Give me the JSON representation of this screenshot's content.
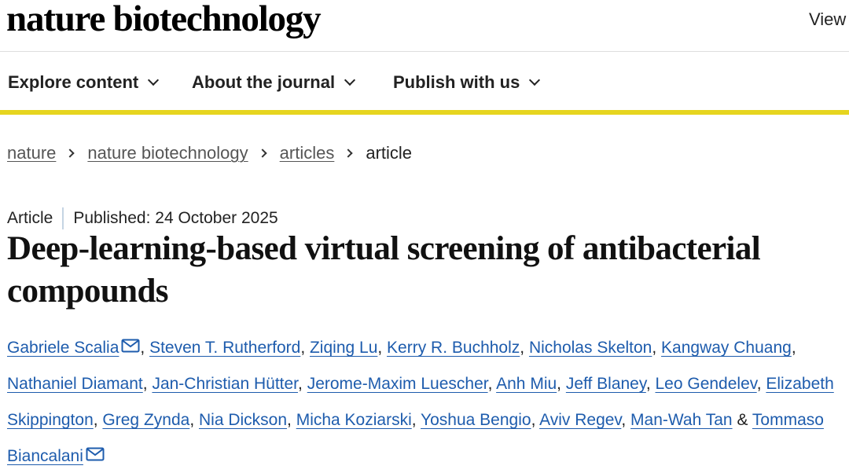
{
  "header": {
    "logo_text": "nature biotechnology",
    "view_link": "View"
  },
  "nav": {
    "items": [
      {
        "label": "Explore content"
      },
      {
        "label": "About the journal"
      },
      {
        "label": "Publish with us"
      }
    ],
    "accent_color": "#e6d51f"
  },
  "breadcrumb": {
    "items": [
      "nature",
      "nature biotechnology",
      "articles"
    ],
    "current": "article"
  },
  "article": {
    "type": "Article",
    "published": "Published: 24 October 2025",
    "title": "Deep-learning-based virtual screening of antibacterial compounds",
    "authors": [
      "Gabriele Scalia",
      "Steven T. Rutherford",
      "Ziqing Lu",
      "Kerry R. Buchholz",
      "Nicholas Skelton",
      "Kangway Chuang",
      "Nathaniel Diamant",
      "Jan-Christian Hütter",
      "Jerome-Maxim Luescher",
      "Anh Miu",
      "Jeff Blaney",
      "Leo Gendelev",
      "Elizabeth Skippington",
      "Greg Zynda",
      "Nia Dickson",
      "Micha Koziarski",
      "Yoshua Bengio",
      "Aviv Regev",
      "Man-Wah Tan",
      "Tommaso Biancalani"
    ],
    "separator": ", ",
    "final_separator": " & ",
    "link_color": "#1e5cad",
    "mail_icon": "envelope-icon"
  }
}
